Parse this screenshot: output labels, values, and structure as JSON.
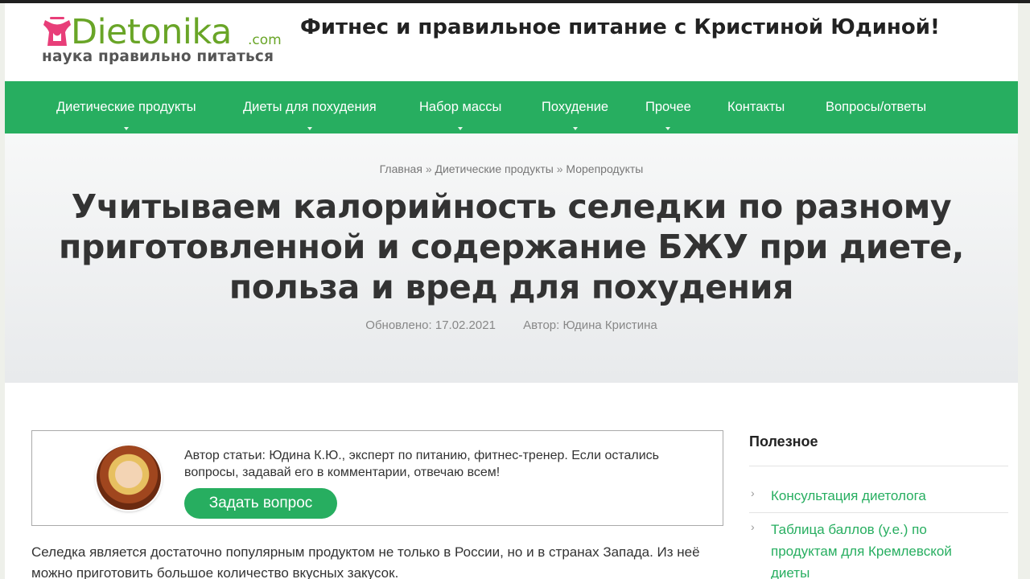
{
  "header": {
    "logo_word": "Dietonika",
    "logo_com": ".com",
    "logo_tagline": "наука правильно питаться",
    "site_title": "Фитнес и правильное питание с Кристиной Юдиной!"
  },
  "nav": {
    "items": [
      {
        "label": "Диетические продукты"
      },
      {
        "label": "Диеты для похудения"
      },
      {
        "label": "Набор массы"
      },
      {
        "label": "Похудение"
      },
      {
        "label": "Прочее"
      },
      {
        "label": "Контакты"
      },
      {
        "label": "Вопросы/ответы"
      }
    ]
  },
  "breadcrumb": {
    "home": "Главная",
    "separator": "»",
    "category": "Диетические продукты",
    "current": "Морепродукты"
  },
  "article": {
    "title_line1": "Учитываем калорийность селедки по разному",
    "title_line2": "приготовленной и содержание БЖУ при диете,",
    "title_line3": "польза и вред для похудения",
    "updated": "Обновлено: 17.02.2021",
    "author": "Автор: Юдина Кристина"
  },
  "author_box": {
    "text": "Автор статьи: Юдина К.Ю., эксперт по питанию, фитнес-тренер. Если остались вопросы, задавай его в комментарии, отвечаю всем!",
    "button_label": "Задать вопрос"
  },
  "body": {
    "paragraph": "Селедка является достаточно популярным продуктом не только в России, но и в странах Запада. Из неё можно приготовить большое количество вкусных закусок."
  },
  "sidebar": {
    "title": "Полезное",
    "items": [
      {
        "label": "Консультация диетолога"
      },
      {
        "label": "Таблица баллов (у.е.) по продуктам для Кремлевской диеты"
      }
    ]
  },
  "colors": {
    "brand_green": "#27ae60",
    "logo_green": "#69a527",
    "logo_pink": "#e83e79"
  }
}
